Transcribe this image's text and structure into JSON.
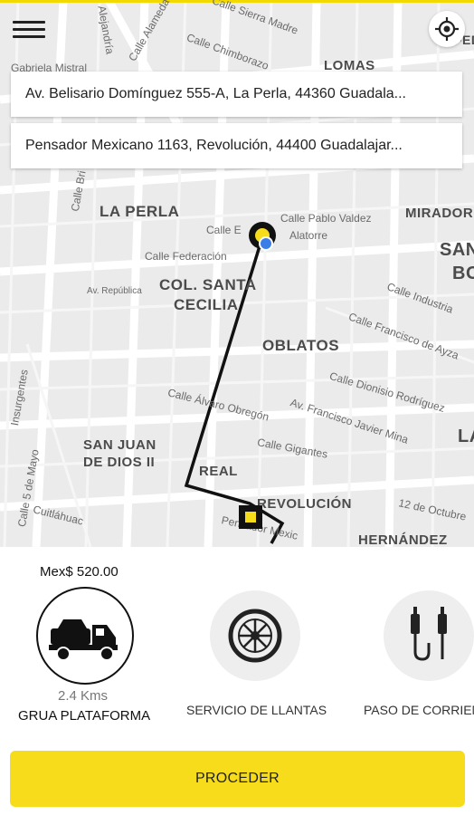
{
  "map": {
    "areas": [
      "LA PERLA",
      "COL. SANTA",
      "CECILIA",
      "OBLATOS",
      "SAN JUAN",
      "DE DIOS II",
      "REAL",
      "REVOLUCIÓN",
      "HERNÁNDEZ",
      "MIRADOR",
      "LOMAS",
      "SAN",
      "BO",
      "LA",
      "FED"
    ],
    "streets": [
      "Calle Sierra Madre",
      "Calle Chimborazo",
      "Calle Alameda",
      "Alejandría",
      "Gabriela Mistral",
      "Calle Pablo Valdez",
      "Calle Federación",
      "Av. República",
      "Calle Industria",
      "Calle Francisco de Ayza",
      "Calle Dionisio Rodríguez",
      "Calle Álvaro Obregón",
      "Av. Francisco Javier Mina",
      "Calle Gigantes",
      "12 de Octubre",
      "Insurgentes",
      "Calle 5 de Mayo",
      "Cuitláhuac",
      "Calle Bri",
      "Calle E",
      "Alatorre",
      "Pensador Mexic"
    ]
  },
  "origin_address": "Av. Belisario Domínguez 555-A, La Perla, 44360 Guadala...",
  "destination_address": "Pensador Mexicano 1163, Revolución, 44400 Guadalajar...",
  "price": "Mex$ 520.00",
  "services": [
    {
      "name": "GRUA PLATAFORMA",
      "distance": "2.4 Kms",
      "icon": "tow-truck-icon",
      "selected": true
    },
    {
      "name": "SERVICIO DE LLANTAS",
      "icon": "tire-icon",
      "selected": false
    },
    {
      "name": "PASO DE CORRIEN",
      "icon": "jumper-cables-icon",
      "selected": false
    }
  ],
  "proceed_label": "PROCEDER",
  "colors": {
    "accent": "#f6dc1b",
    "route": "#111111",
    "map_bg": "#ebebeb"
  }
}
